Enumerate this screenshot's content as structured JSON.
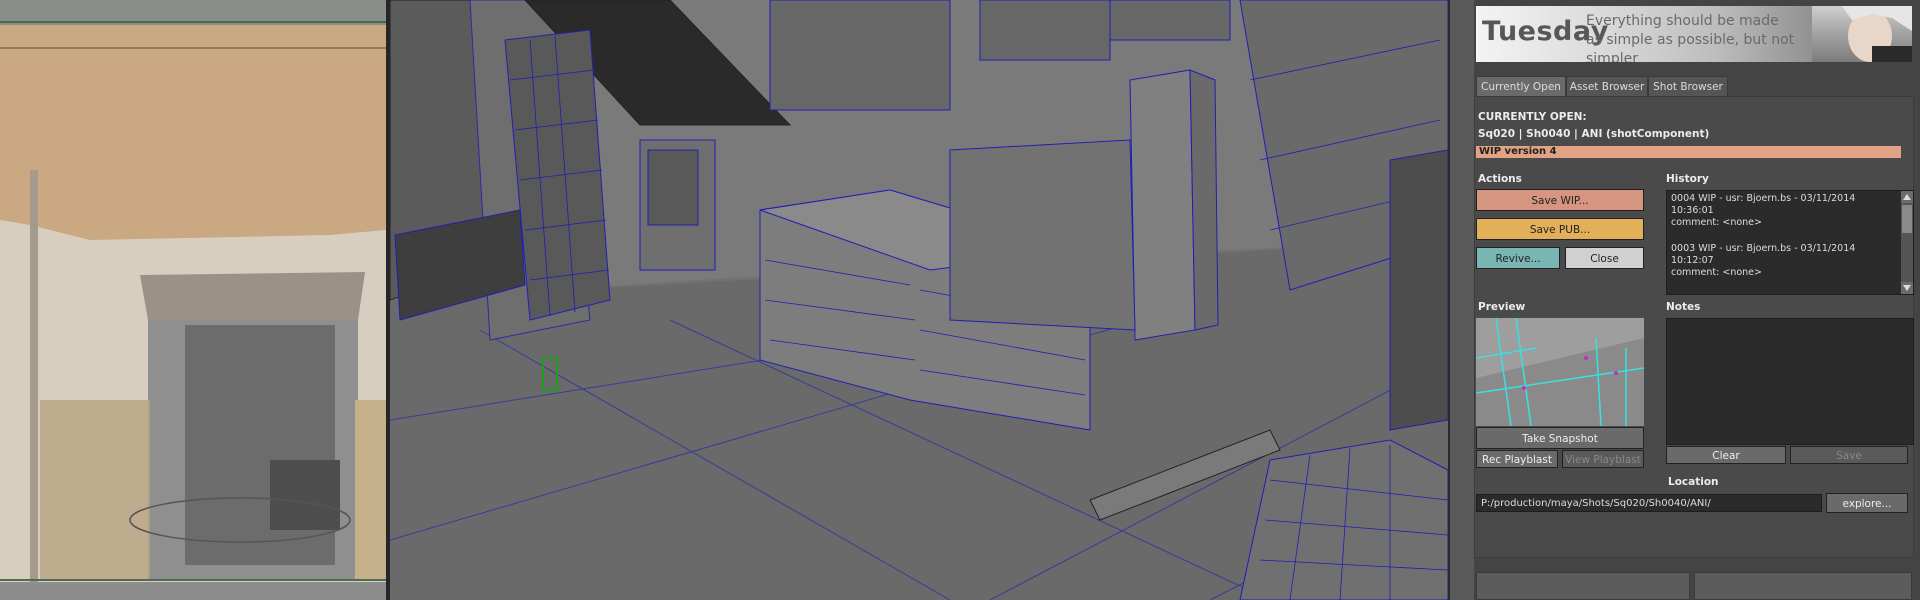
{
  "panel": {
    "title": "Tuesday",
    "tagline": "Everything should be made as simple as possible, but not simpler",
    "tabs": [
      "Currently Open",
      "Asset Browser",
      "Shot Browser"
    ],
    "current_heading": "CURRENTLY OPEN:",
    "current_item": "Sq020 | Sh0040 | ANI (shotComponent)",
    "wip_version": "WIP version 4",
    "actions_label": "Actions",
    "history_label": "History",
    "buttons": {
      "save_wip": "Save WIP...",
      "save_pub": "Save PUB...",
      "revive": "Revive...",
      "close": "Close"
    },
    "history": [
      {
        "line1": "0004 WIP - usr: Bjoern.bs - 03/11/2014",
        "line2": "10:36:01",
        "line3": "comment: <none>"
      },
      {
        "line1": "0003 WIP - usr: Bjoern.bs - 03/11/2014",
        "line2": "10:12:07",
        "line3": "comment: <none>"
      }
    ],
    "preview_label": "Preview",
    "notes_label": "Notes",
    "take_snapshot": "Take Snapshot",
    "rec_playblast": "Rec Playblast",
    "view_playblast": "View Playblast",
    "clear": "Clear",
    "save": "Save",
    "location_label": "Location",
    "location_path": "P:/production/maya/Shots/Sq020/Sh0040/ANI/",
    "explore": "explore..."
  },
  "colors": {
    "save_wip": "#d69580",
    "save_pub": "#e3b05a",
    "revive": "#79b5b3",
    "close": "#d0d0d0",
    "wipbar": "#e1a286"
  }
}
